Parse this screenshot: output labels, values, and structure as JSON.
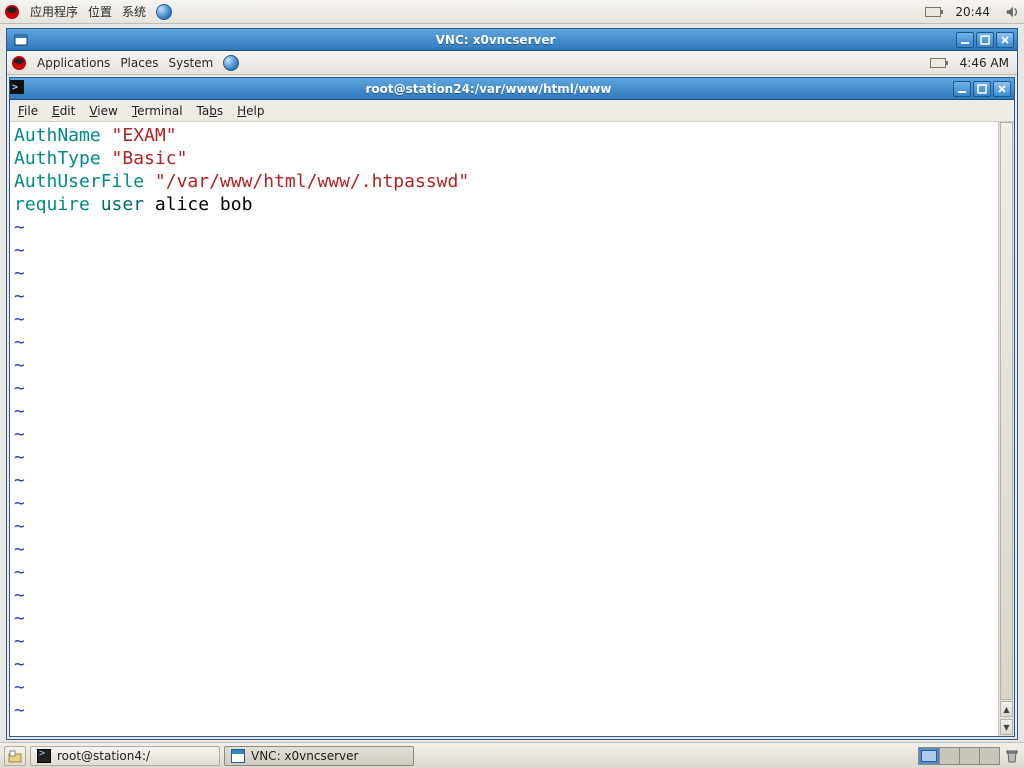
{
  "outer_panel": {
    "menu_apps": "应用程序",
    "menu_places": "位置",
    "menu_system": "系统",
    "clock": "20:44"
  },
  "vnc_window": {
    "title": "VNC: x0vncserver"
  },
  "inner_panel": {
    "menu_apps": "Applications",
    "menu_places": "Places",
    "menu_system": "System",
    "clock": "4:46 AM"
  },
  "terminal": {
    "title": "root@station24:/var/www/html/www",
    "menubar": {
      "file": "File",
      "edit": "Edit",
      "view": "View",
      "terminal": "Terminal",
      "tabs": "Tabs",
      "help": "Help"
    },
    "content": {
      "line1": {
        "kw": "AuthName",
        "str": "\"EXAM\""
      },
      "line2": {
        "kw": "AuthType",
        "str": "\"Basic\""
      },
      "line3": {
        "kw": "AuthUserFile",
        "str": "\"/var/www/html/www/.htpasswd\""
      },
      "line4": {
        "kw1": "require",
        "kw2": "user",
        "rest": " alice bob"
      },
      "tilde": "~"
    }
  },
  "taskbar": {
    "task1": "root@station4:/",
    "task2": "VNC: x0vncserver"
  }
}
